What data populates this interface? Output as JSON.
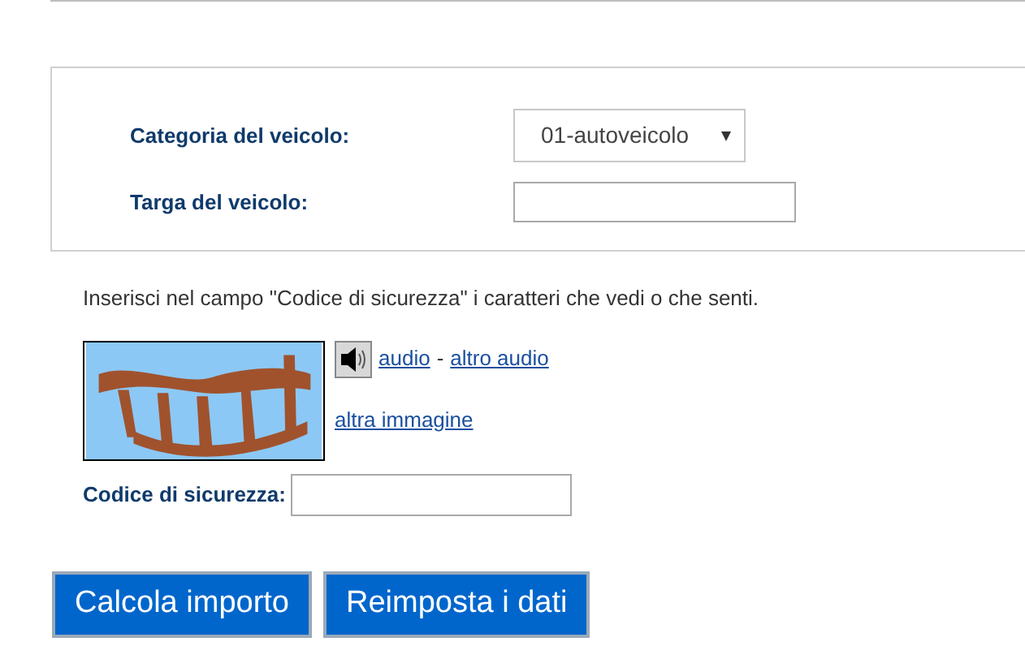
{
  "vehicle_form": {
    "fields": [
      {
        "kind": "select",
        "label": "Categoria del veicolo:",
        "value": "01-autoveicolo"
      },
      {
        "kind": "text",
        "label": "Targa del veicolo:"
      }
    ]
  },
  "captcha": {
    "instruction": "Inserisci nel campo \"Codice di sicurezza\" i caratteri che vedi o che senti.",
    "audio_link": "audio",
    "separator": "-",
    "other_audio_link": "altro audio",
    "other_image_link": "altra immagine",
    "code_label": "Codice di sicurezza:"
  },
  "buttons": [
    "Calcola importo",
    "Reimposta i dati"
  ]
}
